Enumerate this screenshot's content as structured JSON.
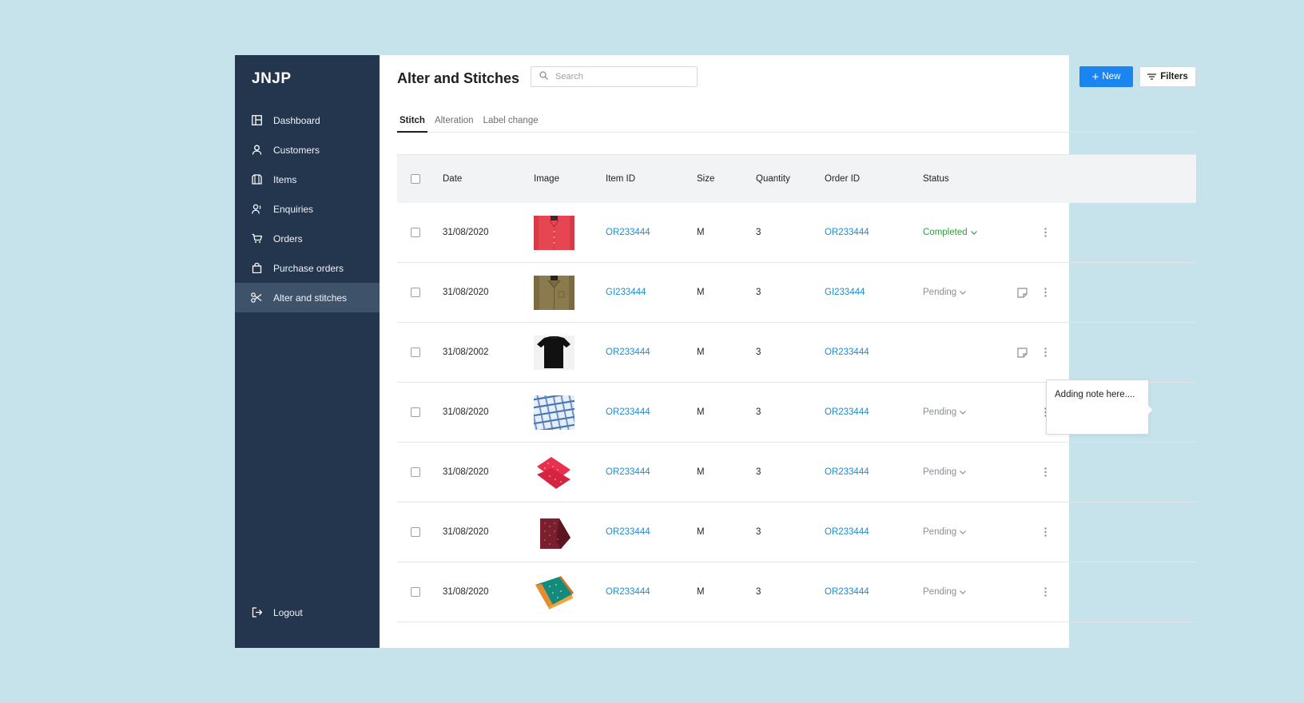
{
  "app": {
    "brand": "JNJP"
  },
  "sidebar": {
    "items": [
      {
        "label": "Dashboard",
        "icon": "dashboard-icon",
        "active": false
      },
      {
        "label": "Customers",
        "icon": "user-icon",
        "active": false
      },
      {
        "label": "Items",
        "icon": "items-icon",
        "active": false
      },
      {
        "label": "Enquiries",
        "icon": "enquiry-icon",
        "active": false
      },
      {
        "label": "Orders",
        "icon": "cart-icon",
        "active": false
      },
      {
        "label": "Purchase orders",
        "icon": "bag-icon",
        "active": false
      },
      {
        "label": "Alter and stitches",
        "icon": "scissors-icon",
        "active": true
      }
    ],
    "logout_label": "Logout"
  },
  "header": {
    "title": "Alter and Stitches",
    "search_placeholder": "Search",
    "new_label": "New",
    "filters_label": "Filters"
  },
  "tabs": [
    {
      "label": "Stitch",
      "active": true
    },
    {
      "label": "Alteration",
      "active": false
    },
    {
      "label": "Label change",
      "active": false
    }
  ],
  "table": {
    "columns": [
      "Date",
      "Image",
      "Item ID",
      "Size",
      "Quantity",
      "Order ID",
      "Status"
    ],
    "rows": [
      {
        "date": "31/08/2020",
        "image": "red-shirt",
        "item_id": "OR233444",
        "size": "M",
        "quantity": "3",
        "order_id": "OR233444",
        "status": "Completed",
        "has_note": false
      },
      {
        "date": "31/08/2020",
        "image": "khaki-shirt",
        "item_id": "GI233444",
        "size": "M",
        "quantity": "3",
        "order_id": "GI233444",
        "status": "Pending",
        "has_note": true
      },
      {
        "date": "31/08/2002",
        "image": "black-tshirt",
        "item_id": "OR233444",
        "size": "M",
        "quantity": "3",
        "order_id": "OR233444",
        "status": "",
        "has_note": true
      },
      {
        "date": "31/08/2020",
        "image": "blue-check-fabric",
        "item_id": "OR233444",
        "size": "M",
        "quantity": "3",
        "order_id": "OR233444",
        "status": "Pending",
        "has_note": false
      },
      {
        "date": "31/08/2020",
        "image": "pink-fabric",
        "item_id": "OR233444",
        "size": "M",
        "quantity": "3",
        "order_id": "OR233444",
        "status": "Pending",
        "has_note": false
      },
      {
        "date": "31/08/2020",
        "image": "maroon-fabric",
        "item_id": "OR233444",
        "size": "M",
        "quantity": "3",
        "order_id": "OR233444",
        "status": "Pending",
        "has_note": false
      },
      {
        "date": "31/08/2020",
        "image": "saree",
        "item_id": "OR233444",
        "size": "M",
        "quantity": "3",
        "order_id": "OR233444",
        "status": "Pending",
        "has_note": false
      }
    ]
  },
  "note_popover": {
    "text": "Adding note here...."
  },
  "colors": {
    "background": "#c6e3eb",
    "sidebar": "#23364d",
    "sidebar_active": "#3e526a",
    "primary": "#1a84f0",
    "link": "#1c8dd1",
    "completed": "#2ea043",
    "pending": "#8a8f96"
  }
}
